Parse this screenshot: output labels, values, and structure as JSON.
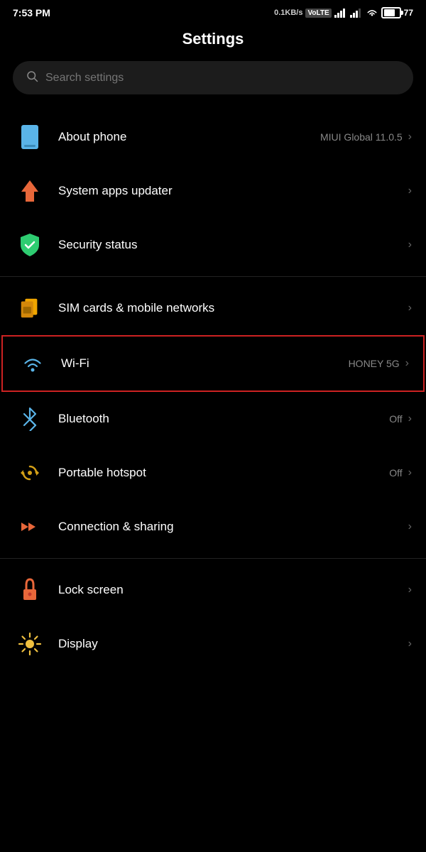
{
  "statusBar": {
    "time": "7:53 PM",
    "speed": "0.1KB/s",
    "networkType": "VoLTE",
    "batteryPercent": "77"
  },
  "pageTitle": "Settings",
  "search": {
    "placeholder": "Search settings"
  },
  "settingsGroups": [
    {
      "id": "group-system",
      "items": [
        {
          "id": "about-phone",
          "title": "About phone",
          "subtitle": "MIUI Global 11.0.5",
          "icon": "phone-icon",
          "iconColor": "#5ab4e8",
          "hasChevron": true
        },
        {
          "id": "system-apps-updater",
          "title": "System apps updater",
          "subtitle": "",
          "icon": "arrow-up-icon",
          "iconColor": "#e8673a",
          "hasChevron": true
        },
        {
          "id": "security-status",
          "title": "Security status",
          "subtitle": "",
          "icon": "shield-icon",
          "iconColor": "#2ecc71",
          "hasChevron": true
        }
      ]
    },
    {
      "id": "group-connectivity",
      "items": [
        {
          "id": "sim-cards",
          "title": "SIM cards & mobile networks",
          "subtitle": "",
          "icon": "sim-icon",
          "iconColor": "#f0a500",
          "hasChevron": true,
          "highlighted": false
        },
        {
          "id": "wifi",
          "title": "Wi-Fi",
          "subtitle": "HONEY 5G",
          "icon": "wifi-icon",
          "iconColor": "#5ab4e8",
          "hasChevron": true,
          "highlighted": true
        },
        {
          "id": "bluetooth",
          "title": "Bluetooth",
          "subtitle": "Off",
          "icon": "bluetooth-icon",
          "iconColor": "#5ab4e8",
          "hasChevron": true
        },
        {
          "id": "portable-hotspot",
          "title": "Portable hotspot",
          "subtitle": "Off",
          "icon": "hotspot-icon",
          "iconColor": "#d4a017",
          "hasChevron": true
        },
        {
          "id": "connection-sharing",
          "title": "Connection & sharing",
          "subtitle": "",
          "icon": "connection-icon",
          "iconColor": "#e8673a",
          "hasChevron": true
        }
      ]
    },
    {
      "id": "group-personalization",
      "items": [
        {
          "id": "lock-screen",
          "title": "Lock screen",
          "subtitle": "",
          "icon": "lock-icon",
          "iconColor": "#e8673a",
          "hasChevron": true
        },
        {
          "id": "display",
          "title": "Display",
          "subtitle": "",
          "icon": "display-icon",
          "iconColor": "#f0c040",
          "hasChevron": true
        }
      ]
    }
  ],
  "chevronChar": "›"
}
